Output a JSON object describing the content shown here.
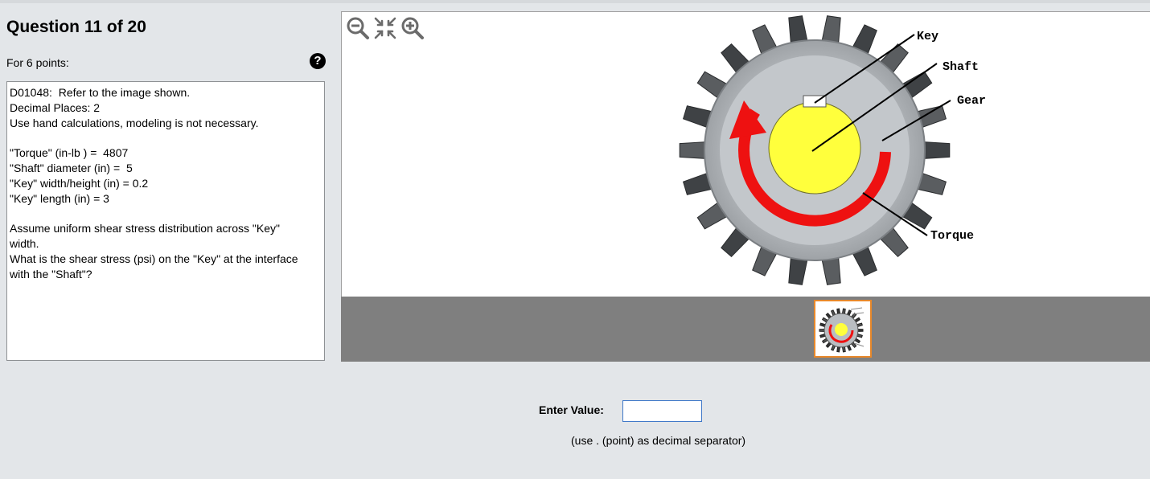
{
  "question": {
    "title": "Question 11 of 20",
    "points_label": "For 6 points:",
    "help_symbol": "?",
    "lines": [
      "D01048:  Refer to the image shown.",
      "Decimal Places: 2",
      "Use hand calculations, modeling is not necessary.",
      "",
      "\"Torque\" (in-lb ) =  4807",
      "\"Shaft\" diameter (in) =  5",
      "\"Key\" width/height (in) = 0.2",
      "\"Key\" length (in) = 3",
      "",
      "Assume uniform shear stress distribution across \"Key\"",
      "width.",
      "What is the shear stress (psi) on the \"Key\" at the interface",
      "with the \"Shaft\"?"
    ]
  },
  "viewer": {
    "tools": [
      "zoom-out-icon",
      "fit-to-view-icon",
      "zoom-in-icon"
    ],
    "labels": {
      "key": "Key",
      "shaft": "Shaft",
      "gear": "Gear",
      "torque": "Torque"
    },
    "colors": {
      "gear": "#bfc3c7",
      "gear_dark": "#4a4d50",
      "shaft": "#ffff3c",
      "arrow": "#ee1111",
      "thumb_border": "#e8882a"
    }
  },
  "answer": {
    "label": "Enter Value:",
    "value": "",
    "hint": "(use . (point) as decimal separator)"
  }
}
